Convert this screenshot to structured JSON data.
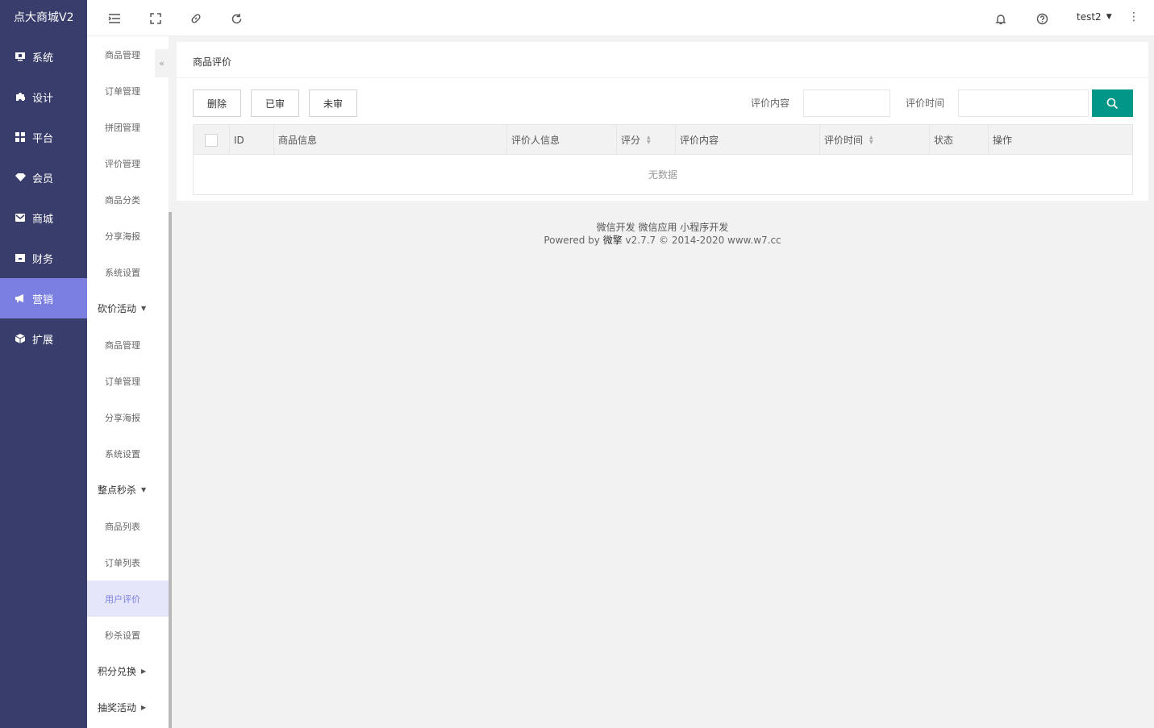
{
  "app": {
    "title": "点大商城V2"
  },
  "sidebar": {
    "items": [
      {
        "label": "系统",
        "icon": "monitor-icon"
      },
      {
        "label": "设计",
        "icon": "puzzle-icon"
      },
      {
        "label": "平台",
        "icon": "grid-icon"
      },
      {
        "label": "会员",
        "icon": "diamond-icon"
      },
      {
        "label": "商城",
        "icon": "mail-icon"
      },
      {
        "label": "财务",
        "icon": "wallet-icon"
      },
      {
        "label": "营销",
        "icon": "megaphone-icon",
        "active": true
      },
      {
        "label": "扩展",
        "icon": "cube-icon"
      }
    ]
  },
  "submenu": {
    "g0": [
      "商品管理",
      "订单管理",
      "拼团管理",
      "评价管理",
      "商品分类",
      "分享海报",
      "系统设置"
    ],
    "group1": "砍价活动",
    "g1": [
      "商品管理",
      "订单管理",
      "分享海报",
      "系统设置"
    ],
    "group2": "整点秒杀",
    "g2": [
      "商品列表",
      "订单列表",
      "用户评价",
      "秒杀设置"
    ],
    "group3": "积分兑换",
    "group4": "抽奖活动"
  },
  "topbar": {
    "user": "test2"
  },
  "page": {
    "title": "商品评价",
    "buttons": {
      "delete": "删除",
      "approved": "已审",
      "unapproved": "未审"
    },
    "filters": {
      "content_label": "评价内容",
      "time_label": "评价时间",
      "content_value": "",
      "time_value": ""
    },
    "accent_color": "#009688"
  },
  "table": {
    "headers": {
      "id": "ID",
      "product": "商品信息",
      "reviewer": "评价人信息",
      "score": "评分",
      "content": "评价内容",
      "time": "评价时间",
      "status": "状态",
      "action": "操作"
    },
    "empty_text": "无数据"
  },
  "footer": {
    "line1": "微信开发 微信应用 小程序开发",
    "powered": "Powered by ",
    "brand": "微擎",
    "version": " v2.7.7 © 2014-2020 www.w7.cc"
  }
}
